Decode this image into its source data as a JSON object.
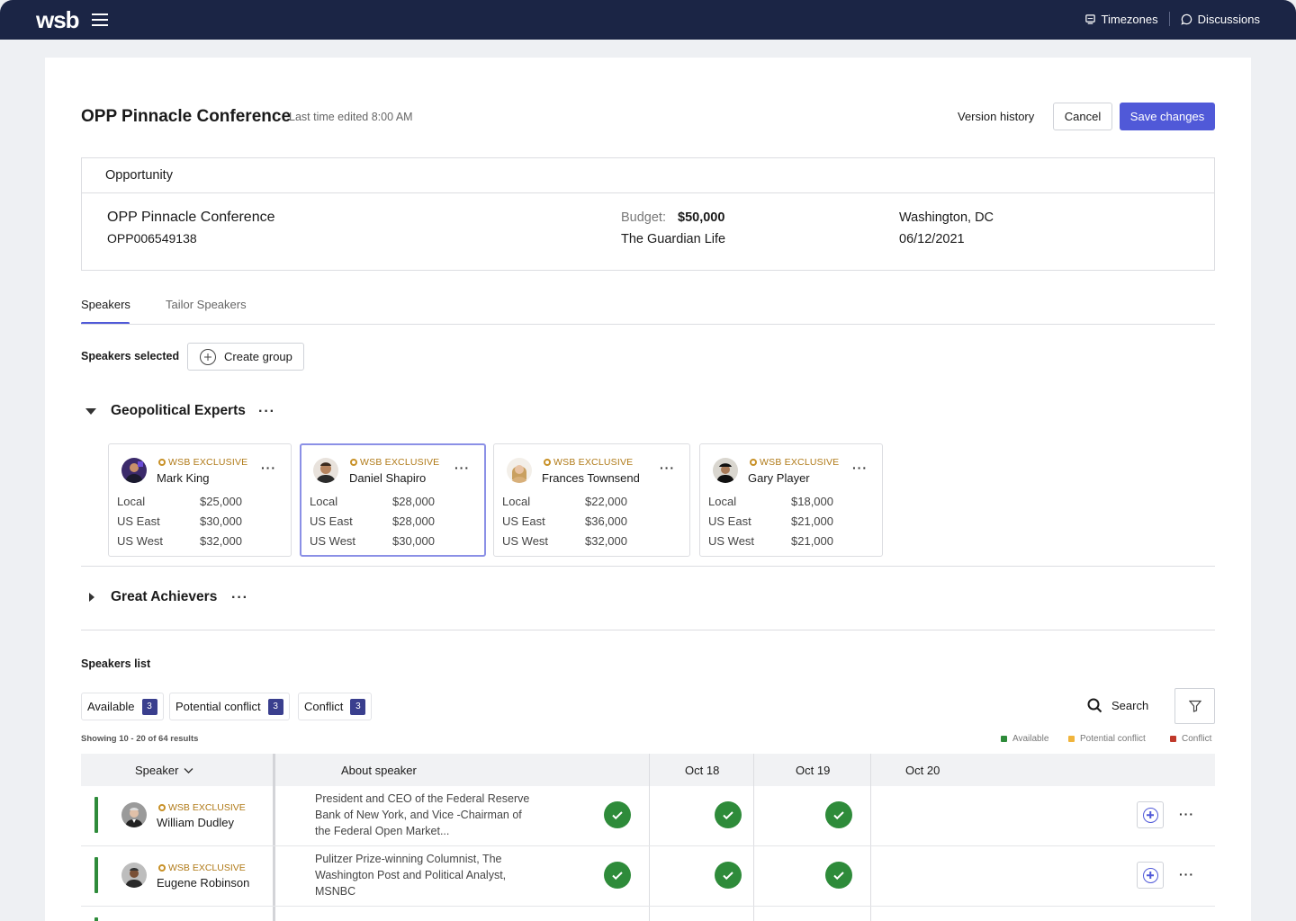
{
  "topbar": {
    "logo": "wsb",
    "timezones": "Timezones",
    "discussions": "Discussions"
  },
  "header": {
    "title": "OPP Pinnacle Conference",
    "edited": "Last time edited 8:00 AM",
    "version_history": "Version history",
    "cancel": "Cancel",
    "save": "Save changes"
  },
  "opportunity": {
    "heading": "Opportunity",
    "name": "OPP Pinnacle Conference",
    "id": "OPP006549138",
    "budget_label": "Budget:",
    "budget": "$50,000",
    "company": "The Guardian Life",
    "city": "Washington, DC",
    "date": "06/12/2021"
  },
  "tabs": [
    "Speakers",
    "Tailor Speakers"
  ],
  "selected": {
    "label": "Speakers selected",
    "create_group": "Create group"
  },
  "groups": [
    {
      "title": "Geopolitical Experts",
      "speakers": [
        {
          "badge": "WSB EXCLUSIVE",
          "name": "Mark King",
          "rates": [
            [
              "Local",
              "$25,000"
            ],
            [
              "US East",
              "$30,000"
            ],
            [
              "US West",
              "$32,000"
            ]
          ]
        },
        {
          "badge": "WSB EXCLUSIVE",
          "name": "Daniel Shapiro",
          "rates": [
            [
              "Local",
              "$28,000"
            ],
            [
              "US East",
              "$28,000"
            ],
            [
              "US West",
              "$30,000"
            ]
          ]
        },
        {
          "badge": "WSB EXCLUSIVE",
          "name": "Frances Townsend",
          "rates": [
            [
              "Local",
              "$22,000"
            ],
            [
              "US East",
              "$36,000"
            ],
            [
              "US West",
              "$32,000"
            ]
          ]
        },
        {
          "badge": "WSB EXCLUSIVE",
          "name": "Gary Player",
          "rates": [
            [
              "Local",
              "$18,000"
            ],
            [
              "US East",
              "$21,000"
            ],
            [
              "US West",
              "$21,000"
            ]
          ]
        }
      ]
    },
    {
      "title": "Great Achievers"
    }
  ],
  "speakers_list": {
    "title": "Speakers list",
    "filters": [
      {
        "label": "Available",
        "count": "3"
      },
      {
        "label": "Potential conflict",
        "count": "3"
      },
      {
        "label": "Conflict",
        "count": "3"
      }
    ],
    "search": "Search",
    "showing": "Showing 10 - 20 of 64 results",
    "legend": [
      {
        "label": "Available",
        "color": "#2e8b3a"
      },
      {
        "label": "Potential conflict",
        "color": "#f0b43c"
      },
      {
        "label": "Conflict",
        "color": "#c0392b"
      }
    ],
    "columns": [
      "Speaker",
      "About speaker",
      "Oct 18",
      "Oct 19",
      "Oct 20"
    ],
    "rows": [
      {
        "badge": "WSB EXCLUSIVE",
        "name": "William Dudley",
        "about": "President and CEO of the Federal Reserve Bank of New York, and Vice -Chairman of the Federal Open Market..."
      },
      {
        "badge": "WSB EXCLUSIVE",
        "name": "Eugene Robinson",
        "about": "Pulitzer Prize-winning Columnist, The Washington Post and Political Analyst, MSNBC"
      }
    ]
  },
  "colors": {
    "topbar": "#1b2545",
    "accent": "#5059d8",
    "available": "#2e8b3a",
    "exclusive": "#b07a18"
  }
}
